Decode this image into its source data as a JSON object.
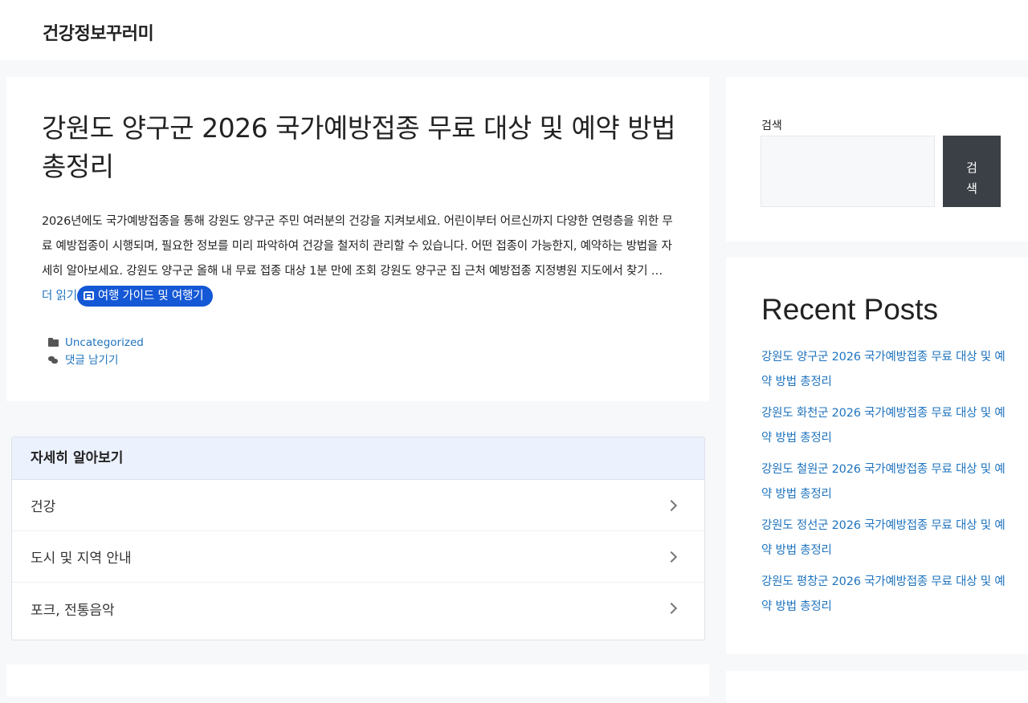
{
  "site": {
    "title": "건강정보꾸러미"
  },
  "post": {
    "title": "강원도 양구군 2026 국가예방접종 무료 대상 및 예약 방법 총정리",
    "excerpt": " 2026년에도 국가예방접종을 통해 강원도 양구군 주민 여러분의 건강을 지켜보세요. 어린이부터 어르신까지 다양한 연령층을 위한 무료 예방접종이 시행되며, 필요한 정보를 미리 파악하여 건강을 철저히 관리할 수 있습니다. 어떤 접종이 가능한지, 예약하는 방법을 자세히 알아보세요.   강원도 양구군 올해 내 무료 접종 대상 1분 만에 조회   강원도 양구군 집 근처 예방접종 지정병원 지도에서 찾기  … ",
    "more_label": "더 읽기",
    "guide_button": "여행 가이드 및 여행기",
    "category": "Uncategorized",
    "comment_label": "댓글 남기기"
  },
  "learn_more": {
    "heading": "자세히 알아보기",
    "items": [
      {
        "label": "건강"
      },
      {
        "label": "도시 및 지역 안내"
      },
      {
        "label": "포크, 전통음악"
      }
    ]
  },
  "search": {
    "label": "검색",
    "button": "검색",
    "placeholder": ""
  },
  "recent": {
    "title": "Recent Posts",
    "items": [
      {
        "label": "강원도 양구군 2026 국가예방접종 무료 대상 및 예약 방법 총정리"
      },
      {
        "label": "강원도 화천군 2026 국가예방접종 무료 대상 및 예약 방법 총정리"
      },
      {
        "label": "강원도 철원군 2026 국가예방접종 무료 대상 및 예약 방법 총정리"
      },
      {
        "label": "강원도 정선군 2026 국가예방접종 무료 대상 및 예약 방법 총정리"
      },
      {
        "label": "강원도 평창군 2026 국가예방접종 무료 대상 및 예약 방법 총정리"
      }
    ]
  },
  "colors": {
    "link": "#1e73be",
    "guide_button": "#1558d6",
    "search_button": "#3a4046",
    "learn_header": "#ebf1fd"
  }
}
